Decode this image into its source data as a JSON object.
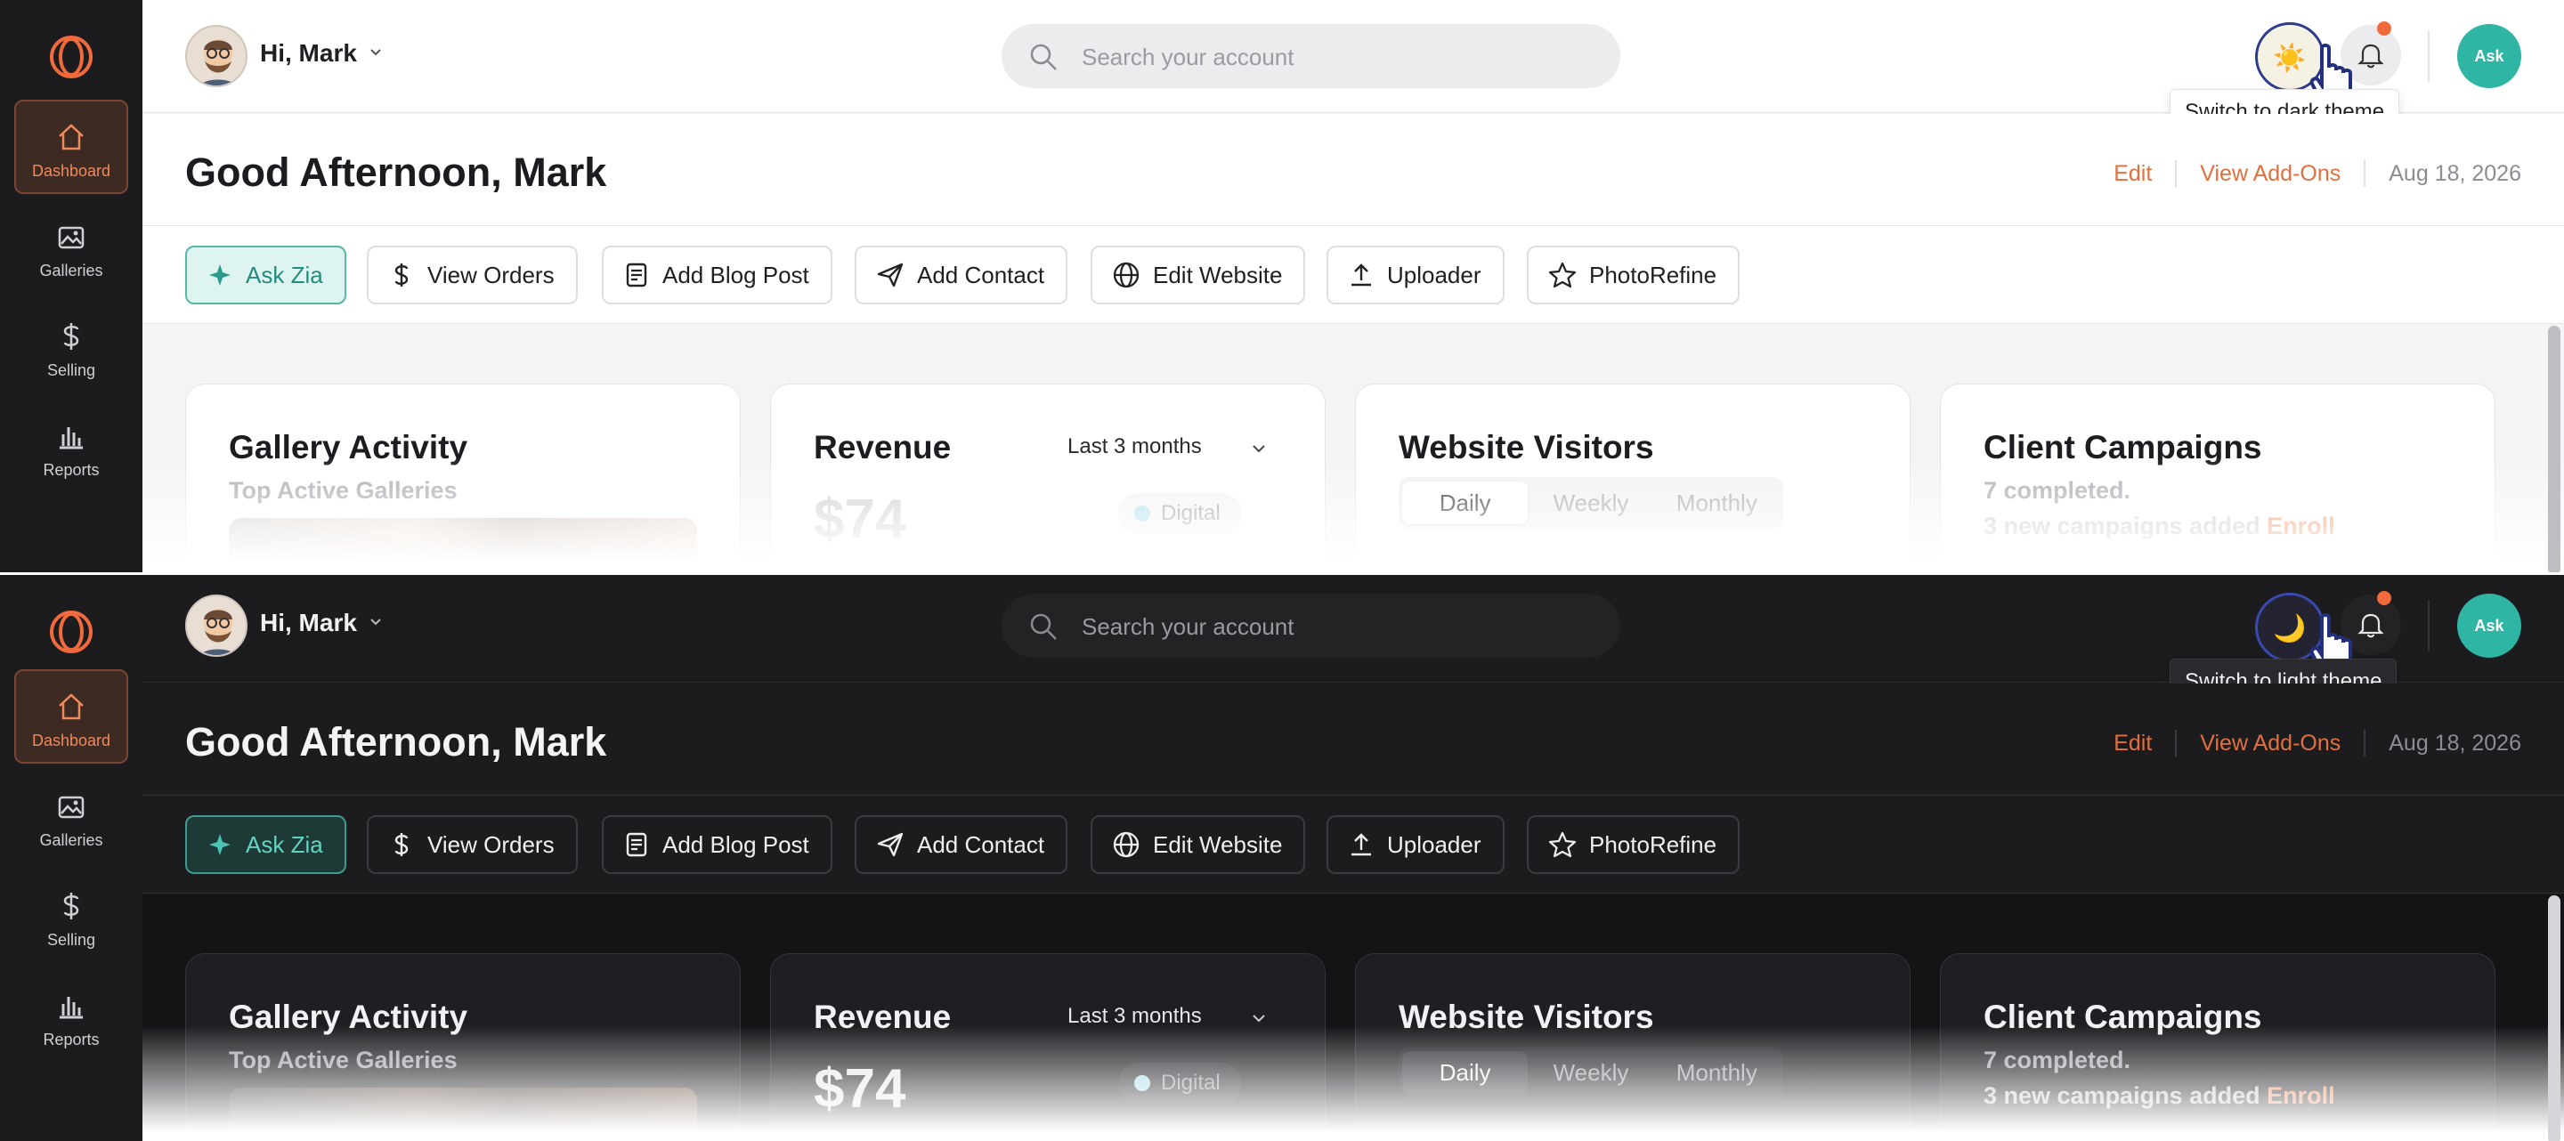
{
  "sidebar": {
    "items": [
      {
        "label": "Dashboard",
        "icon": "home-icon",
        "active": true
      },
      {
        "label": "Galleries",
        "icon": "gallery-icon"
      },
      {
        "label": "Selling",
        "icon": "dollar-icon"
      },
      {
        "label": "Reports",
        "icon": "bar-chart-icon"
      }
    ]
  },
  "topbar": {
    "greeting": "Hi, Mark",
    "search_placeholder": "Search your account",
    "ask_label": "Ask"
  },
  "light_panel": {
    "theme_icon": "☀️",
    "tooltip": "Switch to dark theme"
  },
  "dark_panel": {
    "theme_icon": "🌙",
    "tooltip": "Switch to light theme"
  },
  "header": {
    "title": "Good Afternoon, Mark",
    "edit_label": "Edit",
    "addons_label": "View Add-Ons",
    "date": "Aug 18, 2026"
  },
  "actions": [
    {
      "label": "Ask Zia",
      "icon": "sparkle-icon"
    },
    {
      "label": "View Orders",
      "icon": "dollar-icon"
    },
    {
      "label": "Add Blog Post",
      "icon": "document-icon"
    },
    {
      "label": "Add Contact",
      "icon": "send-icon"
    },
    {
      "label": "Edit Website",
      "icon": "globe-icon"
    },
    {
      "label": "Uploader",
      "icon": "upload-icon"
    },
    {
      "label": "PhotoRefine",
      "icon": "star-icon"
    }
  ],
  "cards": {
    "gallery": {
      "title": "Gallery Activity",
      "subtitle": "Top Active Galleries"
    },
    "revenue": {
      "title": "Revenue",
      "range": "Last 3 months",
      "amount": "$74",
      "legend": "Digital"
    },
    "visitors": {
      "title": "Website Visitors",
      "tabs": [
        "Daily",
        "Weekly",
        "Monthly"
      ],
      "active_tab": "Daily"
    },
    "campaigns": {
      "title": "Client Campaigns",
      "completed": "7 completed.",
      "new_text": "3 new campaigns added",
      "enroll_label": "Enroll"
    }
  },
  "colors": {
    "accent": "#e0703f",
    "teal": "#2fb5a4",
    "notification": "#f06a3c"
  }
}
